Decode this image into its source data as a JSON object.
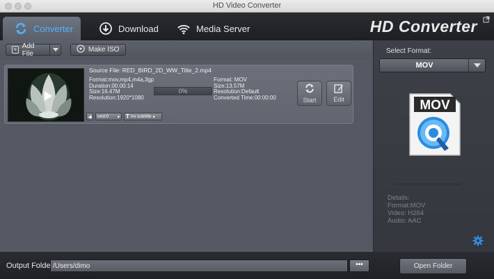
{
  "window": {
    "title": "HD Video Converter"
  },
  "tabs": [
    {
      "label": "Converter",
      "icon": "refresh-icon",
      "active": true
    },
    {
      "label": "Download",
      "icon": "download-icon",
      "active": false
    },
    {
      "label": "Media Server",
      "icon": "wifi-icon",
      "active": false
    }
  ],
  "brand": "HD Converter",
  "toolbar": {
    "add_file_label": "Add File",
    "make_iso_label": "Make ISO"
  },
  "item": {
    "source_file": "Source File: RED_BIRD_2D_WW_Title_2.mp4",
    "source": {
      "format": "Format:mov,mp4,m4a,3gp",
      "duration": "Duration:00:00:14",
      "size": "Size:16.47M",
      "resolution": "Resolution:1920*1080"
    },
    "progress": "0%",
    "output": {
      "format": "Format: MOV",
      "size": "Size:13.57M",
      "resolution": "Resolution:Default",
      "converted_time": "Converted Time:00:00:00"
    },
    "start_label": "Start",
    "edit_label": "Edit",
    "audio_track": "und:0",
    "subtitle": "no subtitle"
  },
  "right_panel": {
    "select_format_label": "Select Format:",
    "selected_format": "MOV",
    "icon_text": "MOV",
    "details": {
      "heading": "Details:",
      "format": "Format:MOV",
      "video": "Video: H264",
      "audio": "Audio: AAC"
    }
  },
  "bottom": {
    "output_folder_label": "Output Folder:",
    "output_folder_value": "/Users/dimo",
    "browse_label": "•••",
    "open_folder_label": "Open Folder"
  },
  "colors": {
    "accent": "#4fb4ff",
    "panel": "#51555f",
    "header": "#1d1f23"
  }
}
